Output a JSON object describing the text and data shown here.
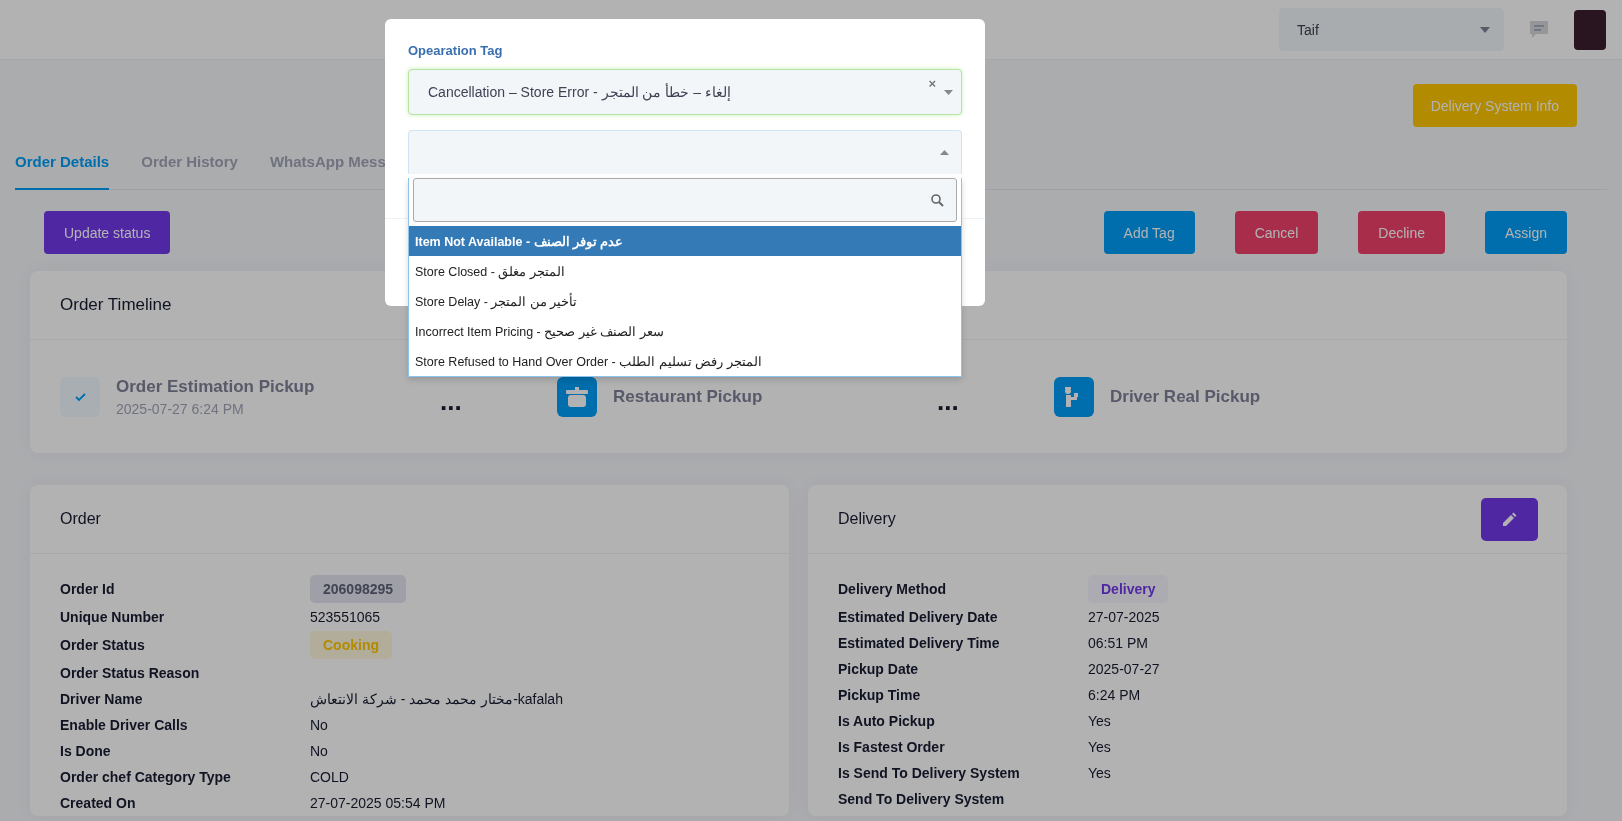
{
  "header": {
    "city_select": {
      "value": "Taif"
    }
  },
  "delivery_system_button": {
    "label": "Delivery System Info"
  },
  "tabs": [
    {
      "label": "Order Details",
      "selected": true
    },
    {
      "label": "Order History",
      "selected": false
    },
    {
      "label": "WhatsApp Mess",
      "selected": false
    }
  ],
  "actions": {
    "left": [
      {
        "label": "Update status",
        "kind": "purple"
      }
    ],
    "right": [
      {
        "label": "Add Tag",
        "kind": "blue"
      },
      {
        "label": "Cancel",
        "kind": "red"
      },
      {
        "label": "Decline",
        "kind": "red"
      },
      {
        "label": "Assign",
        "kind": "blue"
      }
    ]
  },
  "timeline": {
    "title": "Order Timeline",
    "steps": [
      {
        "title": "Order Estimation Pickup",
        "time": "2025-07-27 6:24 PM",
        "done": true
      },
      {
        "title": "Restaurant Pickup",
        "done": false
      },
      {
        "title": "Driver Real Pickup",
        "done": false
      }
    ],
    "separators": [
      "...",
      "..."
    ]
  },
  "order": {
    "title": "Order",
    "rows": [
      {
        "label": "Order Id",
        "value": "206098295",
        "kind": "neutral"
      },
      {
        "label": "Unique Number",
        "value": "523551065",
        "kind": "text"
      },
      {
        "label": "Order Status",
        "value": "Cooking",
        "kind": "warning"
      },
      {
        "label": "Order Status Reason",
        "kind": "text"
      },
      {
        "label": "Driver Name",
        "value": "مختار محمد محمد - شركة الانتعاش-kafalah",
        "kind": "text"
      },
      {
        "label": "Enable Driver Calls",
        "value": "No",
        "kind": "text"
      },
      {
        "label": "Is Done",
        "value": "No",
        "kind": "text"
      },
      {
        "label": "Order chef Category Type",
        "value": "COLD",
        "kind": "text"
      },
      {
        "label": "Created On",
        "value": "27-07-2025 05:54 PM",
        "kind": "text"
      }
    ]
  },
  "delivery": {
    "title": "Delivery",
    "rows": [
      {
        "label": "Delivery Method",
        "value": "Delivery",
        "kind": "primary"
      },
      {
        "label": "Estimated Delivery Date",
        "value": "27-07-2025",
        "kind": "text"
      },
      {
        "label": "Estimated Delivery Time",
        "value": "06:51 PM",
        "kind": "text"
      },
      {
        "label": "Pickup Date",
        "value": "2025-07-27",
        "kind": "text"
      },
      {
        "label": "Pickup Time",
        "value": "6:24 PM",
        "kind": "text"
      },
      {
        "label": "Is Auto Pickup",
        "value": "Yes",
        "kind": "text"
      },
      {
        "label": "Is Fastest Order",
        "value": "Yes",
        "kind": "text"
      },
      {
        "label": "Is Send To Delivery System",
        "value": "Yes",
        "kind": "text"
      },
      {
        "label": "Send To Delivery System",
        "kind": "text"
      }
    ]
  },
  "modal": {
    "label": "Opearation Tag",
    "tag_select": {
      "value": "Cancellation – Store Error - إلغاء – خطأ من المتجر",
      "clear": "×"
    },
    "reason_select": {
      "expanded": true,
      "options": [
        {
          "label": "Item Not Available - عدم توفر الصنف",
          "selected": true
        },
        {
          "label": "Store Closed - المتجر مغلق",
          "selected": false
        },
        {
          "label": "Store Delay - تأخير من المتجر",
          "selected": false
        },
        {
          "label": "Incorrect Item Pricing - سعر الصنف غير صحيح",
          "selected": false
        },
        {
          "label": "Store Refused to Hand Over Order - المتجر رفض تسليم الطلب",
          "selected": false
        }
      ]
    }
  }
}
